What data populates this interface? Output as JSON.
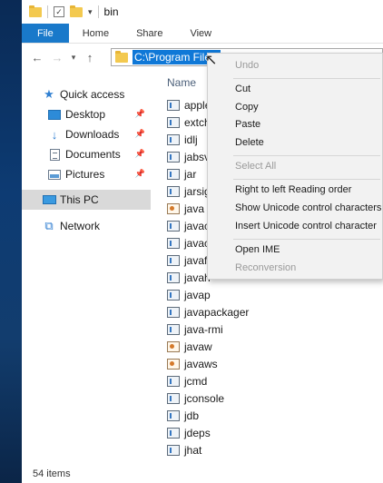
{
  "window": {
    "title": "bin"
  },
  "ribbon": {
    "tabs": [
      "File",
      "Home",
      "Share",
      "View"
    ]
  },
  "address": {
    "path": "C:\\Program Files\\"
  },
  "nav": {
    "quick_access": "Quick access",
    "desktop": "Desktop",
    "downloads": "Downloads",
    "documents": "Documents",
    "pictures": "Pictures",
    "this_pc": "This PC",
    "network": "Network"
  },
  "filelist": {
    "header": "Name",
    "files": [
      "apple",
      "extch",
      "idlj",
      "jabsv",
      "jar",
      "jarsig",
      "java",
      "javac",
      "javac",
      "javaf",
      "javah",
      "javap",
      "javapackager",
      "java-rmi",
      "javaw",
      "javaws",
      "jcmd",
      "jconsole",
      "jdb",
      "jdeps",
      "jhat"
    ]
  },
  "status": {
    "items": "54 items"
  },
  "context_menu": {
    "undo": "Undo",
    "cut": "Cut",
    "copy": "Copy",
    "paste": "Paste",
    "delete": "Delete",
    "select_all": "Select All",
    "rtl": "Right to left Reading order",
    "show_unicode": "Show Unicode control characters",
    "insert_unicode": "Insert Unicode control character",
    "open_ime": "Open IME",
    "reconversion": "Reconversion"
  }
}
